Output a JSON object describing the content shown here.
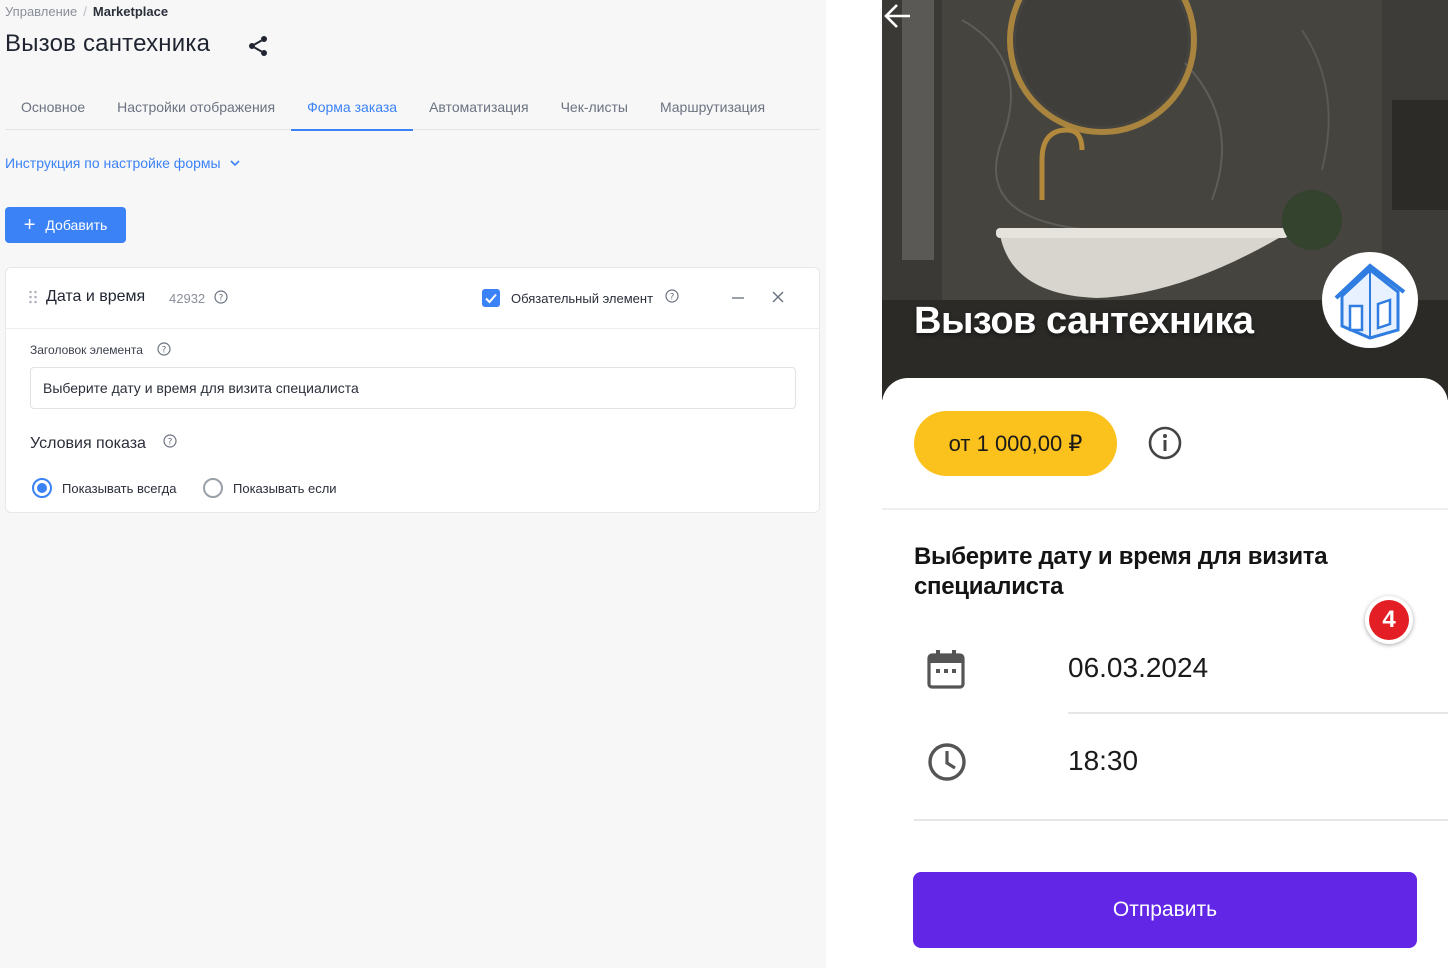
{
  "breadcrumb": {
    "parent": "Управление",
    "separator": "/",
    "current": "Marketplace"
  },
  "page": {
    "title": "Вызов сантехника"
  },
  "tabs": [
    {
      "label": "Основное",
      "active": false
    },
    {
      "label": "Настройки отображения",
      "active": false
    },
    {
      "label": "Форма заказа",
      "active": true
    },
    {
      "label": "Автоматизация",
      "active": false
    },
    {
      "label": "Чек-листы",
      "active": false
    },
    {
      "label": "Маршрутизация",
      "active": false
    }
  ],
  "instructions": {
    "label": "Инструкция по настройке формы"
  },
  "toolbar": {
    "add_label": "Добавить"
  },
  "element": {
    "title": "Дата и время",
    "id": "42932",
    "required_label": "Обязательный элемент",
    "required": true,
    "header_field_label": "Заголовок элемента",
    "header_field_value": "Выберите дату и время для визита специалиста",
    "conditions_title": "Условия показа",
    "radio_always": "Показывать всегда",
    "radio_if": "Показывать если",
    "selected_condition": "always"
  },
  "preview": {
    "title": "Вызов сантехника",
    "price": "от 1 000,00 ₽",
    "prompt": "Выберите дату и время для визита специалиста",
    "badge": "4",
    "date": "06.03.2024",
    "time": "18:30",
    "submit_label": "Отправить"
  },
  "colors": {
    "accent": "#3b82f6",
    "price_pill": "#fbc11d",
    "submit": "#6226e6",
    "badge": "#e31e24"
  },
  "icons": [
    "share-icon",
    "chevron-down-icon",
    "plus-icon",
    "drag-handle-icon",
    "help-icon",
    "checkbox-icon",
    "minimize-icon",
    "close-icon",
    "back-arrow-icon",
    "house-icon",
    "info-icon",
    "calendar-icon",
    "clock-icon"
  ]
}
